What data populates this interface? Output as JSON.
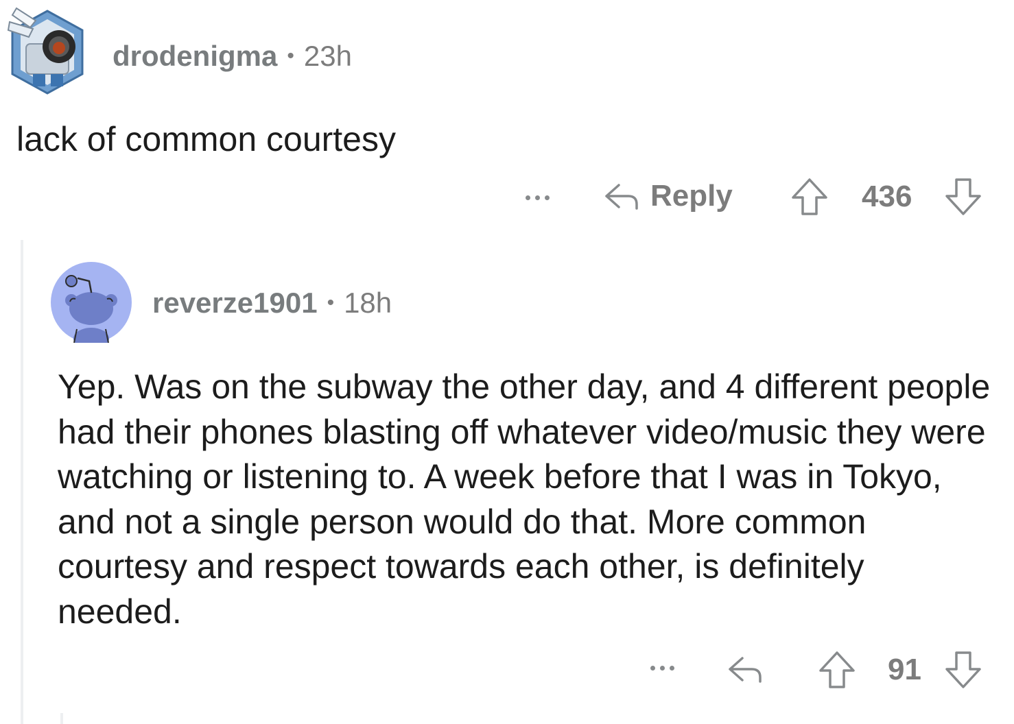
{
  "comments": [
    {
      "username": "drodenigma",
      "separator": "•",
      "age": "23h",
      "body": "lack of common courtesy",
      "reply_label": "Reply",
      "score": "436",
      "avatar_icon": "robot-avatar-icon"
    },
    {
      "username": "reverze1901",
      "separator": "•",
      "age": "18h",
      "body": "Yep. Was on the subway the other day, and 4 different people had their phones blasting off whatever video/music they were watching or listening to. A week before that I was in Tokyo, and not a single person would do that. More common courtesy and respect towards each other, is definitely needed.",
      "score": "91",
      "avatar_icon": "default-snoo-avatar-icon"
    }
  ],
  "colors": {
    "meta_text": "#7c7c7c",
    "body_text": "#1c1c1c",
    "thread_line": "#edeff1",
    "default_avatar_bg": "#a5b4f2",
    "default_avatar_fg": "#6e7fc8"
  }
}
